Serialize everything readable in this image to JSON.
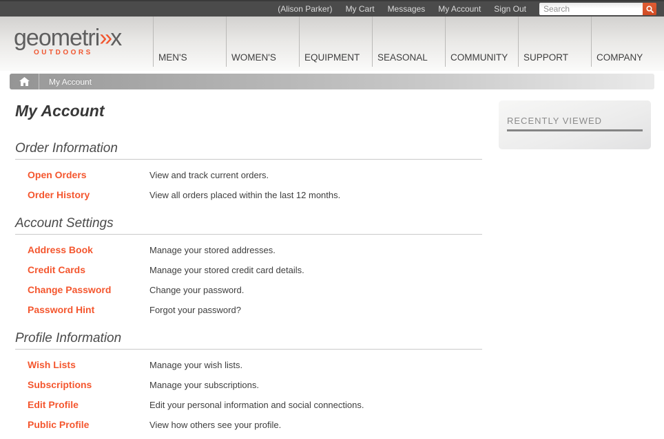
{
  "topbar": {
    "links": [
      "(Alison Parker)",
      "My Cart",
      "Messages",
      "My Account",
      "Sign Out"
    ],
    "search": {
      "placeholder": "Search"
    }
  },
  "nav": {
    "logo": {
      "main": "geometri",
      "accent": "»",
      "end": "x",
      "tagline": "OUTDOORS"
    },
    "items": [
      "MEN'S",
      "WOMEN'S",
      "EQUIPMENT",
      "SEASONAL",
      "COMMUNITY",
      "SUPPORT",
      "COMPANY"
    ]
  },
  "breadcrumb": {
    "current": "My Account"
  },
  "page": {
    "title": "My Account"
  },
  "sections": [
    {
      "title": "Order Information",
      "rows": [
        {
          "link": "Open Orders",
          "desc": "View and track current orders."
        },
        {
          "link": "Order History",
          "desc": "View all orders placed within the last 12 months."
        }
      ]
    },
    {
      "title": "Account Settings",
      "rows": [
        {
          "link": "Address Book",
          "desc": "Manage your stored addresses."
        },
        {
          "link": "Credit Cards",
          "desc": "Manage your stored credit card details."
        },
        {
          "link": "Change Password",
          "desc": "Change your password."
        },
        {
          "link": "Password Hint",
          "desc": "Forgot your password?"
        }
      ]
    },
    {
      "title": "Profile Information",
      "rows": [
        {
          "link": "Wish Lists",
          "desc": "Manage your wish lists."
        },
        {
          "link": "Subscriptions",
          "desc": "Manage your subscriptions."
        },
        {
          "link": "Edit Profile",
          "desc": "Edit your personal information and social connections."
        },
        {
          "link": "Public Profile",
          "desc": "View how others see your profile."
        }
      ]
    }
  ],
  "sidebar": {
    "recently_viewed_title": "RECENTLY VIEWED"
  },
  "colors": {
    "accent_orange": "#f4562e",
    "search_button_orange": "#d6502b",
    "topbar_bg": "#4b4b4b",
    "breadcrumb_left": "#989898",
    "breadcrumb_right": "#eaeaea"
  }
}
